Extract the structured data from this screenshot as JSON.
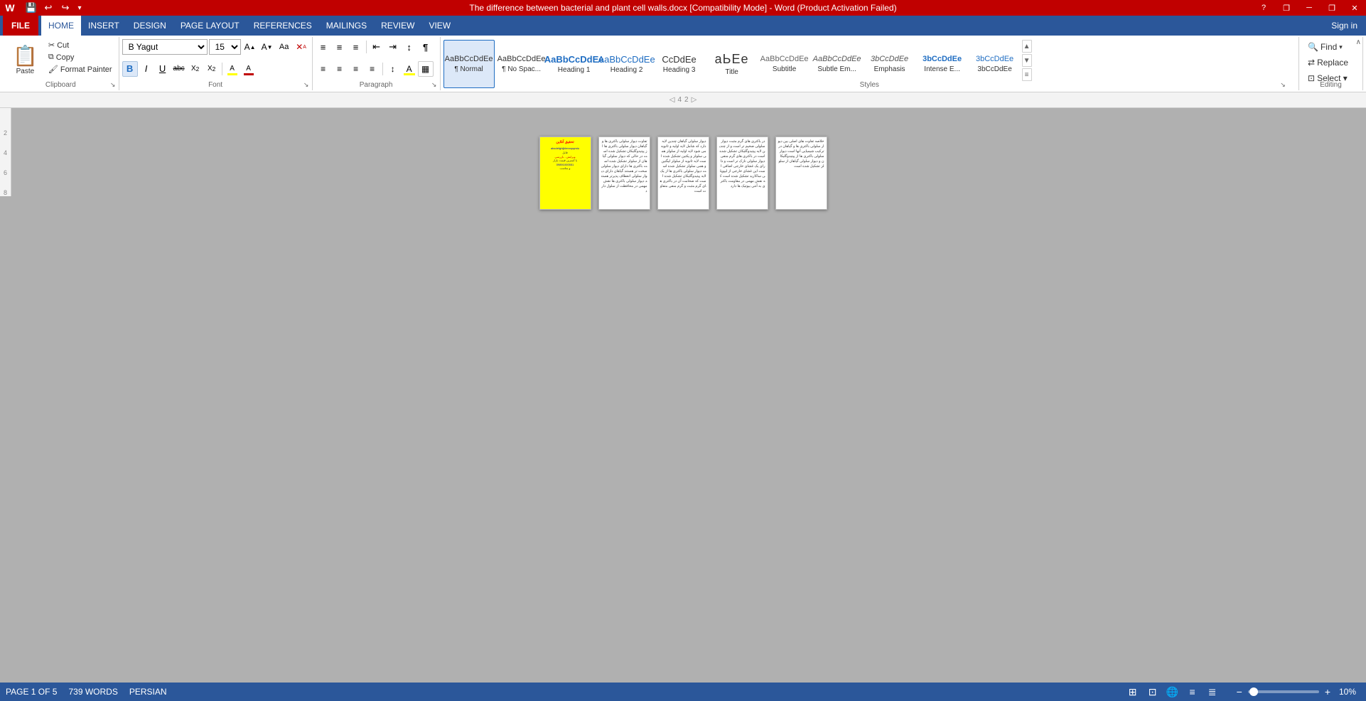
{
  "titlebar": {
    "title": "The difference between bacterial and plant cell walls.docx [Compatibility Mode]  -  Word (Product Activation Failed)",
    "help_icon": "?",
    "restore_icon": "❐",
    "minimize_icon": "─",
    "maximize_icon": "❐",
    "close_icon": "✕"
  },
  "quickaccess": {
    "save_icon": "💾",
    "undo_icon": "↩",
    "redo_icon": "↪",
    "customize_icon": "▾"
  },
  "menubar": {
    "file_label": "FILE",
    "items": [
      "HOME",
      "INSERT",
      "DESIGN",
      "PAGE LAYOUT",
      "REFERENCES",
      "MAILINGS",
      "REVIEW",
      "VIEW"
    ],
    "signin_label": "Sign in"
  },
  "toolbar": {
    "clipboard": {
      "label": "Clipboard",
      "paste_label": "Paste",
      "cut_label": "Cut",
      "copy_label": "Copy",
      "format_painter_label": "Format Painter"
    },
    "font": {
      "label": "Font",
      "font_name": "B Yagut",
      "font_size": "15",
      "grow_icon": "A↑",
      "shrink_icon": "A↓",
      "clear_icon": "✕",
      "bold_label": "B",
      "italic_label": "I",
      "underline_label": "U",
      "strikethrough_label": "abc",
      "subscript_label": "X₂",
      "superscript_label": "X²",
      "color_label": "A"
    },
    "paragraph": {
      "label": "Paragraph"
    },
    "styles": {
      "label": "Styles",
      "items": [
        {
          "key": "normal",
          "preview": "AaBbCcDdEe",
          "label": "¶ Normal",
          "active": true
        },
        {
          "key": "no-spacing",
          "preview": "AaBbCcDdEe",
          "label": "¶ No Spac..."
        },
        {
          "key": "heading1",
          "preview": "AaBbCcDdEe",
          "label": "Heading 1"
        },
        {
          "key": "heading2",
          "preview": "AaBbCcDdEe",
          "label": "Heading 2"
        },
        {
          "key": "heading3",
          "preview": "CcDdEe",
          "label": "Heading 3"
        },
        {
          "key": "title",
          "preview": "аЬЕе",
          "label": "Title"
        },
        {
          "key": "subtitle",
          "preview": "AaBbCcDdEe",
          "label": "Subtitle"
        },
        {
          "key": "subtle-em",
          "preview": "AaBbCcDdEe",
          "label": "Subtle Em..."
        },
        {
          "key": "emphasis",
          "preview": "3bCcDdEe",
          "label": "Emphasis"
        },
        {
          "key": "intense-e",
          "preview": "3bCcDdEe",
          "label": "Intense E..."
        },
        {
          "key": "intense-e2",
          "preview": "3bCcDdEe",
          "label": "3bCcDdEe"
        }
      ]
    },
    "editing": {
      "label": "Editing",
      "find_label": "Find",
      "replace_label": "Replace",
      "select_label": "Select ▾"
    }
  },
  "ruler": {
    "markers": [
      "4",
      "2"
    ]
  },
  "statusbar": {
    "page_info": "PAGE 1 OF 5",
    "words": "739 WORDS",
    "language": "PERSIAN",
    "zoom": "10%"
  },
  "pages": [
    {
      "id": 1,
      "type": "cover",
      "bg": "#ffff00"
    },
    {
      "id": 2,
      "type": "text"
    },
    {
      "id": 3,
      "type": "text"
    },
    {
      "id": 4,
      "type": "text"
    },
    {
      "id": 5,
      "type": "text-partial"
    }
  ]
}
